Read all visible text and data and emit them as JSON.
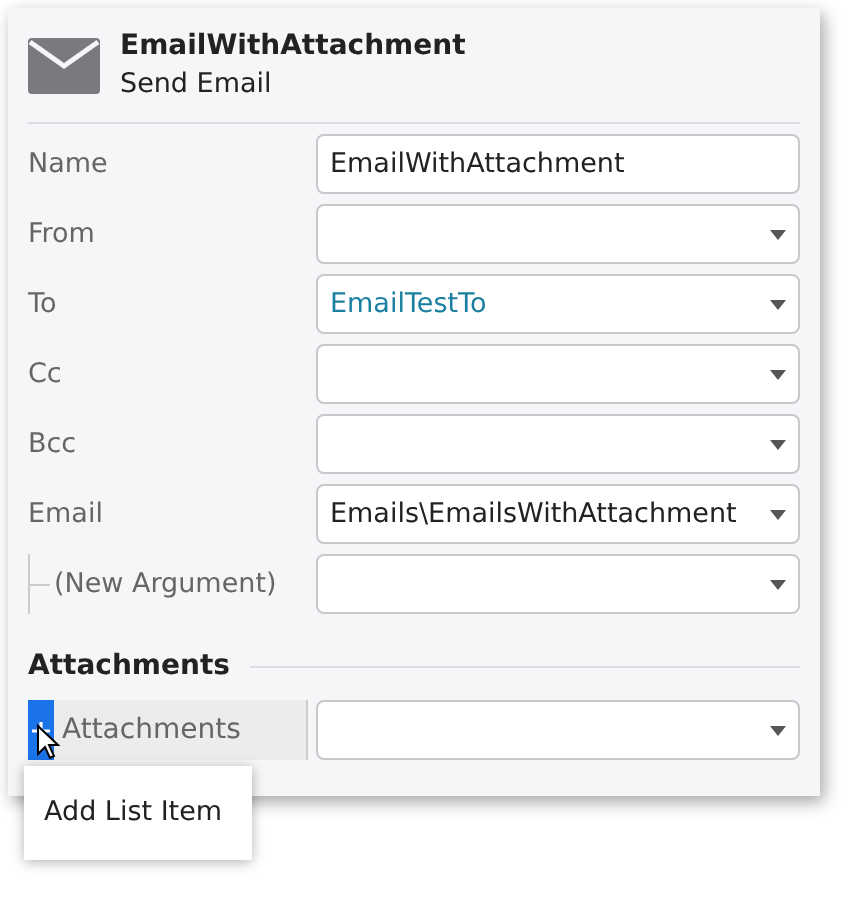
{
  "header": {
    "title": "EmailWithAttachment",
    "subtitle": "Send Email"
  },
  "fields": [
    {
      "label": "Name",
      "kind": "text",
      "value": "EmailWithAttachment",
      "nested": false
    },
    {
      "label": "From",
      "kind": "combo",
      "nested": false
    },
    {
      "label": "To",
      "kind": "combo",
      "value": "EmailTestTo",
      "link": true,
      "nested": false
    },
    {
      "label": "Cc",
      "kind": "combo",
      "nested": false
    },
    {
      "label": "Bcc",
      "kind": "combo",
      "nested": false
    },
    {
      "label": "Email",
      "kind": "combo",
      "value": "Emails\\EmailsWithAttachment",
      "nested": false
    },
    {
      "label": "(New Argument)",
      "kind": "combo",
      "nested": true
    }
  ],
  "section": {
    "title": "Attachments",
    "row_label": "Attachments"
  },
  "menu": {
    "items": [
      "Add List Item"
    ]
  }
}
